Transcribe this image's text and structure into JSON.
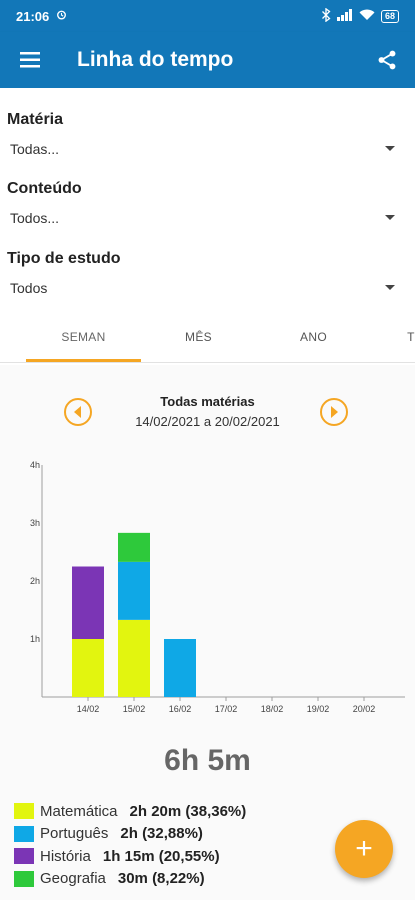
{
  "status_bar": {
    "time": "21:06",
    "battery": "68"
  },
  "app_bar": {
    "title": "Linha do tempo",
    "menu_icon": "menu-icon",
    "share_icon": "share-icon"
  },
  "filters": {
    "materia": {
      "label": "Matéria",
      "value": "Todas..."
    },
    "conteudo": {
      "label": "Conteúdo",
      "value": "Todos..."
    },
    "tipo": {
      "label": "Tipo de estudo",
      "value": "Todos"
    }
  },
  "tabs": [
    {
      "label": "SEMAN",
      "active": true
    },
    {
      "label": "MÊS",
      "active": false
    },
    {
      "label": "ANO",
      "active": false
    },
    {
      "label": "T",
      "active": false
    }
  ],
  "period": {
    "title": "Todas matérias",
    "range": "14/02/2021 a 20/02/2021"
  },
  "colors": {
    "accent": "#f5a623",
    "primary": "#1277b8"
  },
  "chart_data": {
    "type": "bar",
    "stacked": true,
    "categories": [
      "14/02",
      "15/02",
      "16/02",
      "17/02",
      "18/02",
      "19/02",
      "20/02"
    ],
    "y_ticks": [
      "1h",
      "2h",
      "3h",
      "4h"
    ],
    "ylim": [
      0,
      4
    ],
    "y_unit": "hours",
    "series": [
      {
        "name": "Matemática",
        "color": "#e2f50f",
        "values": [
          1.0,
          1.33,
          0,
          0,
          0,
          0,
          0
        ]
      },
      {
        "name": "Português",
        "color": "#0fa8e6",
        "values": [
          0,
          1.0,
          1.0,
          0,
          0,
          0,
          0
        ]
      },
      {
        "name": "História",
        "color": "#7b35b5",
        "values": [
          1.25,
          0,
          0,
          0,
          0,
          0,
          0
        ]
      },
      {
        "name": "Geografia",
        "color": "#2ec93b",
        "values": [
          0,
          0.5,
          0,
          0,
          0,
          0,
          0
        ]
      }
    ]
  },
  "total": "6h 5m",
  "legend": [
    {
      "name": "Matemática",
      "value": "2h 20m (38,36%)",
      "color": "#e2f50f"
    },
    {
      "name": "Português",
      "value": "2h (32,88%)",
      "color": "#0fa8e6"
    },
    {
      "name": "História",
      "value": "1h 15m (20,55%)",
      "color": "#7b35b5"
    },
    {
      "name": "Geografia",
      "value": "30m (8,22%)",
      "color": "#2ec93b"
    }
  ],
  "fab": {
    "label": "+"
  }
}
